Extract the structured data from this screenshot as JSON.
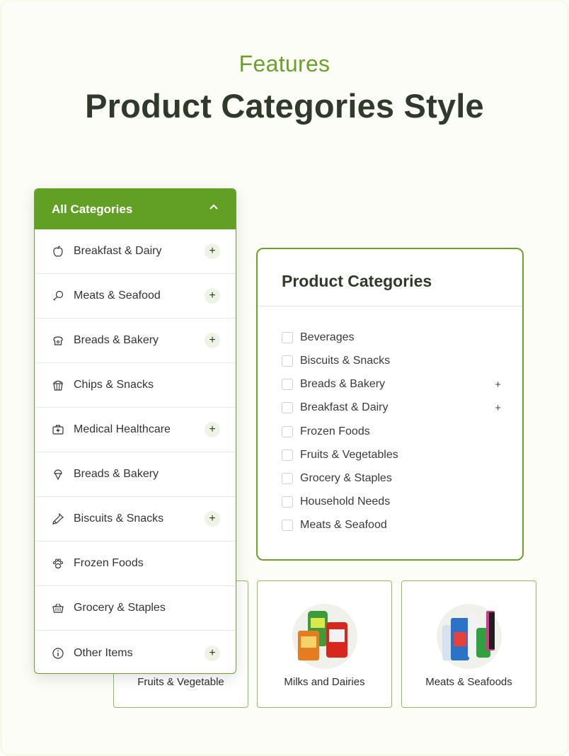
{
  "heading": {
    "eyebrow": "Features",
    "title": "Product Categories Style"
  },
  "menu": {
    "header_label": "All Categories",
    "items": [
      {
        "label": "Breakfast & Dairy",
        "icon": "apple-icon",
        "expandable": true
      },
      {
        "label": "Meats & Seafood",
        "icon": "drumstick-icon",
        "expandable": true
      },
      {
        "label": "Breads & Bakery",
        "icon": "bread-icon",
        "expandable": true
      },
      {
        "label": "Chips & Snacks",
        "icon": "popcorn-icon",
        "expandable": false
      },
      {
        "label": "Medical Healthcare",
        "icon": "first-aid-kit-icon",
        "expandable": true
      },
      {
        "label": "Breads & Bakery",
        "icon": "ice-cream-icon",
        "expandable": false
      },
      {
        "label": "Biscuits & Snacks",
        "icon": "bottle-icon",
        "expandable": true
      },
      {
        "label": "Frozen Foods",
        "icon": "paw-icon",
        "expandable": false
      },
      {
        "label": "Grocery & Staples",
        "icon": "basket-icon",
        "expandable": false
      },
      {
        "label": "Other Items",
        "icon": "info-icon",
        "expandable": true
      }
    ],
    "plus_symbol": "+"
  },
  "panel": {
    "title": "Product Categories",
    "items": [
      {
        "label": "Beverages",
        "expandable": false
      },
      {
        "label": "Biscuits & Snacks",
        "expandable": false
      },
      {
        "label": "Breads & Bakery",
        "expandable": true
      },
      {
        "label": "Breakfast & Dairy",
        "expandable": true
      },
      {
        "label": "Frozen Foods",
        "expandable": false
      },
      {
        "label": "Fruits & Vegetables",
        "expandable": false
      },
      {
        "label": "Grocery & Staples",
        "expandable": false
      },
      {
        "label": "Household Needs",
        "expandable": false
      },
      {
        "label": "Meats & Seafood",
        "expandable": false
      }
    ],
    "plus_symbol": "+"
  },
  "cards": [
    {
      "label": "Fruits & Vegetable"
    },
    {
      "label": "Milks and Dairies"
    },
    {
      "label": "Meats & Seafoods"
    }
  ],
  "colors": {
    "accent": "#62a025",
    "eyebrow": "#6aa22a",
    "heading": "#2f3a2a"
  }
}
